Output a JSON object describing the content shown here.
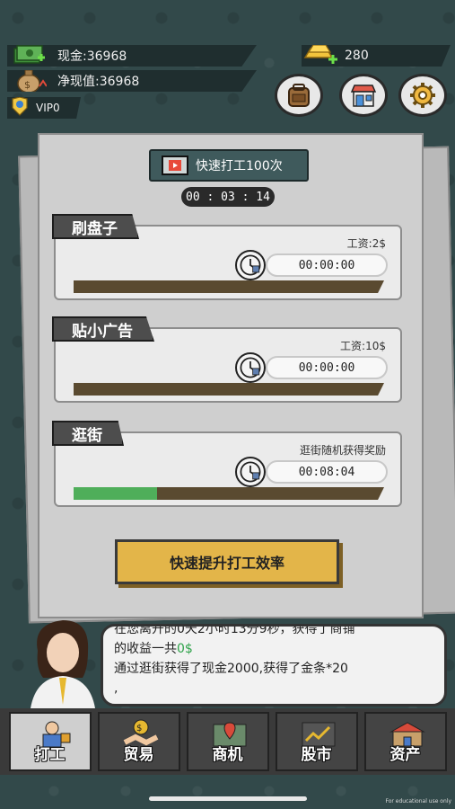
{
  "stats": {
    "cash": "现金:36968",
    "net_worth": "净现值:36968",
    "vip": "VIP0",
    "gold": "280"
  },
  "top_buttons": [
    "backpack-icon",
    "shop-icon",
    "gear-icon"
  ],
  "quick_work_label": "快速打工100次",
  "timer": "00 : 03 : 14",
  "jobs": [
    {
      "name": "刷盘子",
      "wage": "工资:2$",
      "time": "00:00:00",
      "progress": 0
    },
    {
      "name": "贴小广告",
      "wage": "工资:10$",
      "time": "00:00:00",
      "progress": 0
    },
    {
      "name": "逛街",
      "wage": "逛街随机获得奖励",
      "time": "00:08:04",
      "progress": 0.27
    }
  ],
  "boost_label": "快速提升打工效率",
  "dialog": {
    "line1": "在您离开的0天2小时13分9秒，获得了商铺",
    "line2a": "的收益一共",
    "line2b": "0$",
    "line3": "通过逛街获得了现金2000,获得了金条*20",
    "line4": ","
  },
  "nav": [
    {
      "label": "打工",
      "active": true
    },
    {
      "label": "贸易",
      "active": false
    },
    {
      "label": "商机",
      "active": false
    },
    {
      "label": "股市",
      "active": false
    },
    {
      "label": "资产",
      "active": false
    }
  ],
  "edu_note": "For educational use only",
  "colors": {
    "progress_fill": "#4fae5a",
    "boost_button": "#e3b549",
    "profit_green": "#2fa24a"
  }
}
